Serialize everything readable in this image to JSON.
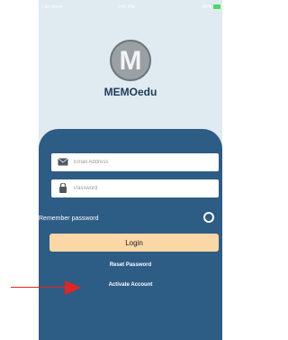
{
  "status_bar": {
    "carrier": "Lite Sheet",
    "time": "9:41 PM",
    "battery": "86%"
  },
  "logo": {
    "letter": "M"
  },
  "app_name": "MEMOedu",
  "email": {
    "placeholder": "Email Address",
    "value": ""
  },
  "password": {
    "placeholder": "Password",
    "value": ""
  },
  "remember": {
    "label": "Remember password",
    "checked": false
  },
  "login_label": "Login",
  "reset_label": "Reset Password",
  "activate_label": "Activate Account",
  "colors": {
    "panel": "#2d5c85",
    "background": "#dfeaf1",
    "login_button": "#fbd7a6",
    "arrow": "#e52421"
  }
}
